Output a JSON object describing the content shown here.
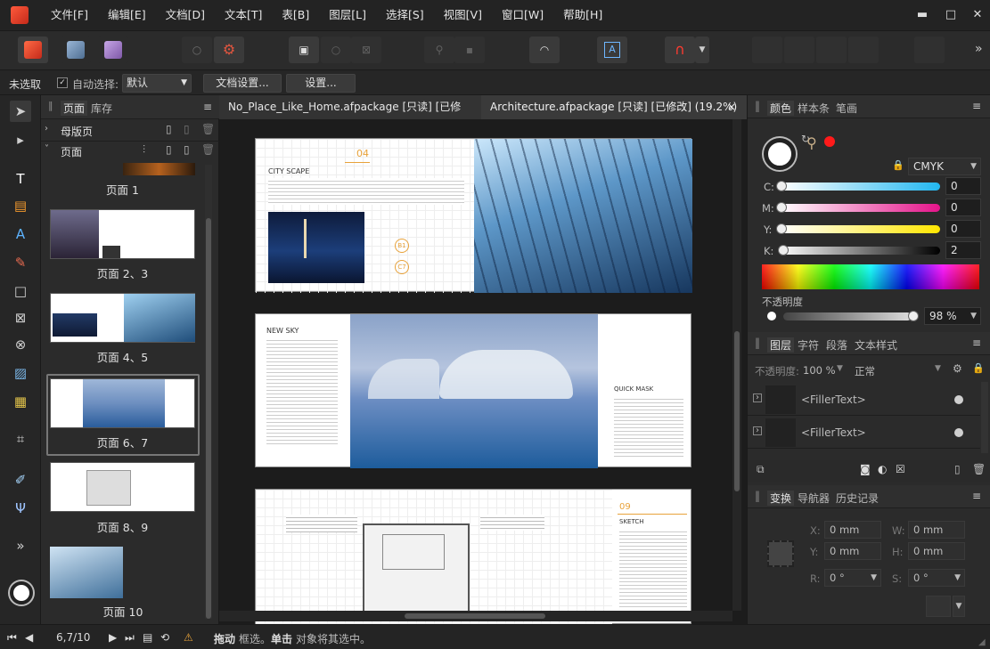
{
  "menu": [
    "文件[F]",
    "编辑[E]",
    "文档[D]",
    "文本[T]",
    "表[B]",
    "图层[L]",
    "选择[S]",
    "视图[V]",
    "窗口[W]",
    "帮助[H]"
  ],
  "window_controls": {
    "minimize": "▬",
    "restore": "□",
    "close": "✕"
  },
  "toolbar": {
    "overflow": "»"
  },
  "context": {
    "no_selection": "未选取",
    "auto_select_label": "自动选择:",
    "auto_select_value": "默认",
    "doc_setup_button": "文档设置...",
    "settings_button": "设置..."
  },
  "pages_panel": {
    "tab_pages": "页面",
    "tab_library": "库存",
    "master_pages": "母版页",
    "pages": "页面",
    "page_labels": [
      "页面 1",
      "页面 2、3",
      "页面 4、5",
      "页面 6、7",
      "页面 8、9",
      "页面 10"
    ]
  },
  "doc_tabs": [
    {
      "title": "No_Place_Like_Home.afpackage [只读] [已修改]...",
      "close": "×"
    },
    {
      "title": "Architecture.afpackage [只读] [已修改] (19.2%)",
      "close": "×"
    }
  ],
  "spreads": {
    "s1": {
      "num": "04",
      "title": "CITY SCAPE",
      "b1": "B1",
      "c7": "C7"
    },
    "s2": {
      "title": "NEW SKY",
      "title2": "QUICK MASK"
    },
    "s3": {
      "num": "09",
      "title": "SKETCH"
    }
  },
  "color_panel": {
    "tabs": [
      "颜色",
      "样本条",
      "笔画"
    ],
    "model": "CMYK",
    "channels": [
      {
        "label": "C:",
        "value": "0"
      },
      {
        "label": "M:",
        "value": "0"
      },
      {
        "label": "Y:",
        "value": "0"
      },
      {
        "label": "K:",
        "value": "2"
      }
    ],
    "opacity_label": "不透明度",
    "opacity_value": "98 %"
  },
  "layers_panel": {
    "tabs": [
      "图层",
      "字符",
      "段落",
      "文本样式"
    ],
    "opacity_label": "不透明度:",
    "opacity_value": "100 %",
    "blend_mode": "正常",
    "rows": [
      "<FillerText>",
      "<FillerText>"
    ]
  },
  "transform_panel": {
    "tabs": [
      "变换",
      "导航器",
      "历史记录"
    ],
    "fields": [
      {
        "label": "X:",
        "value": "0 mm"
      },
      {
        "label": "W:",
        "value": "0 mm"
      },
      {
        "label": "Y:",
        "value": "0 mm"
      },
      {
        "label": "H:",
        "value": "0 mm"
      },
      {
        "label": "R:",
        "value": "0 °"
      },
      {
        "label": "S:",
        "value": "0 °"
      }
    ]
  },
  "status": {
    "page_indicator": "6,7/10",
    "drag": "拖动",
    "marquee": "框选。",
    "click": "单击",
    "message": "对象将其选中。"
  },
  "colors": {
    "accent": "#e8a23a",
    "active_red": "#ff3b30",
    "panel_bg": "#2b2b2b"
  }
}
